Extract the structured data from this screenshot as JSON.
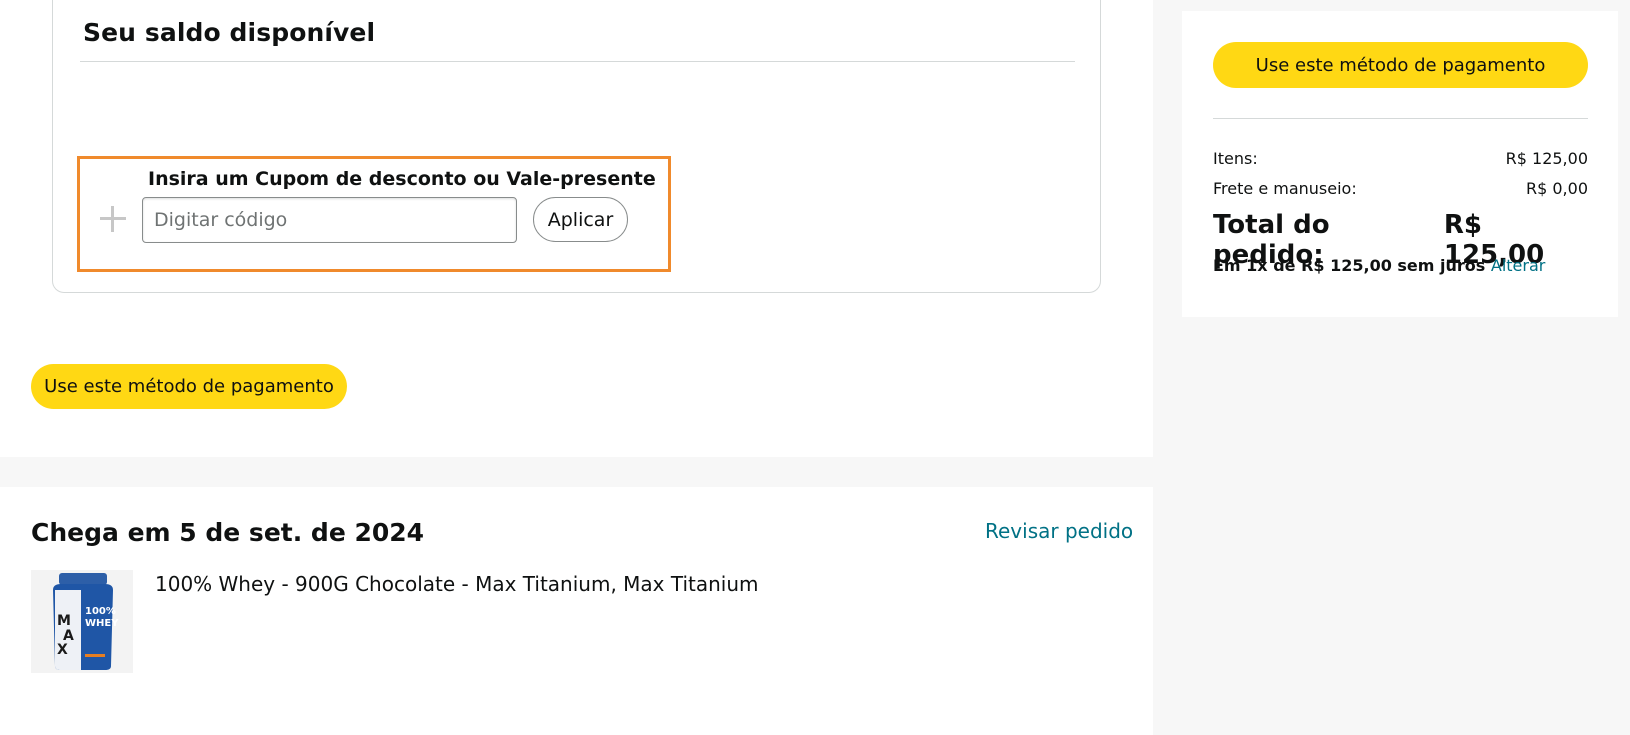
{
  "balance": {
    "title": "Seu saldo disponível"
  },
  "coupon": {
    "heading": "Insira um Cupom de desconto ou Vale-presente",
    "input_placeholder": "Digitar código",
    "input_value": "",
    "apply_label": "Aplicar"
  },
  "left_actions": {
    "use_method_label": "Use este método de pagamento"
  },
  "delivery": {
    "title": "Chega em 5 de set. de 2024",
    "review_link": "Revisar pedido",
    "product": {
      "name": "100% Whey - 900G Chocolate - Max Titanium, Max Titanium",
      "image_label_brand": "MAX",
      "image_label_text": "100% WHEY"
    }
  },
  "summary": {
    "use_method_label": "Use este método de pagamento",
    "items_label": "Itens:",
    "items_value": "R$ 125,00",
    "shipping_label": "Frete e manuseio:",
    "shipping_value": "R$ 0,00",
    "total_label": "Total do pedido:",
    "total_value": "R$ 125,00",
    "installments_text": "Em 1x de R$ 125,00 sem juros",
    "change_link": "Alterar"
  },
  "colors": {
    "primary_button": "#ffd814",
    "highlight_border": "#f08a2c",
    "link": "#007185",
    "background": "#f7f7f7"
  }
}
